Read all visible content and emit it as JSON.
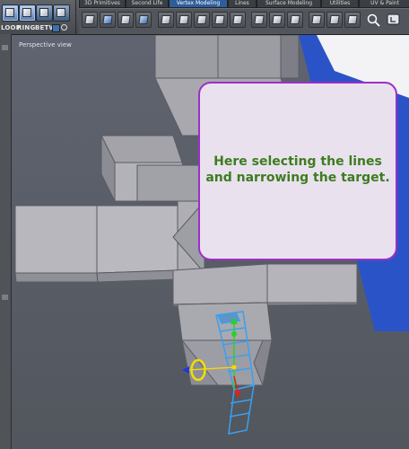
{
  "toolbar": {
    "left_labels": [
      "LOOP",
      "RING",
      "BETW"
    ],
    "tabs": [
      "3D Primitives",
      "Second Life",
      "Vertex Modeling",
      "Lines",
      "Surface Modeling",
      "Utilities",
      "UV & Paint"
    ],
    "active_tab": "Vertex Modeling"
  },
  "viewport": {
    "label": "Perspective view"
  },
  "callout": {
    "line1": "Here selecting the lines",
    "line2": "and narrowing the target.",
    "border_color": "#9b2fc8",
    "text_color": "#3e7c1f"
  },
  "icons": [
    "select-icon",
    "cube-icon",
    "extrude-icon",
    "bevel-icon",
    "lathe-icon",
    "sweep-icon",
    "sphere-icon",
    "cylinder-icon",
    "cone-icon",
    "torus-icon",
    "loop-icon",
    "weld-icon",
    "split-icon",
    "subdivide-icon",
    "smooth-icon",
    "add-icon",
    "magnet-icon"
  ]
}
